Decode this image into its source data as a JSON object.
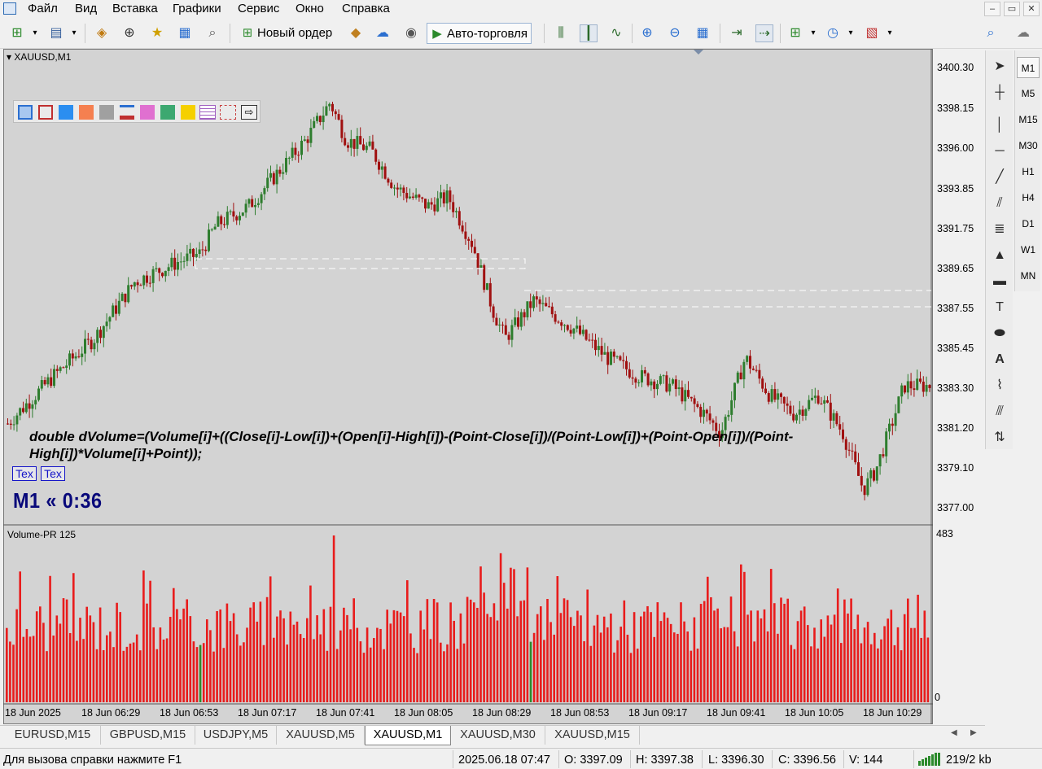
{
  "menu": {
    "items": [
      "Файл",
      "Вид",
      "Вставка",
      "Графики",
      "Сервис",
      "Окно",
      "Справка"
    ]
  },
  "toolbar": {
    "new_order": "Новый ордер",
    "auto_trading": "Авто-торговля"
  },
  "chart": {
    "title": "XAUUSD,M1",
    "price_axis": [
      "3400.30",
      "3398.15",
      "3396.00",
      "3393.85",
      "3391.75",
      "3389.65",
      "3387.55",
      "3385.45",
      "3383.30",
      "3381.20",
      "3379.10",
      "3377.00"
    ],
    "time_axis": [
      "18 Jun 2025",
      "18 Jun 06:29",
      "18 Jun 06:53",
      "18 Jun 07:17",
      "18 Jun 07:41",
      "18 Jun 08:05",
      "18 Jun 08:29",
      "18 Jun 08:53",
      "18 Jun 09:17",
      "18 Jun 09:41",
      "18 Jun 10:05",
      "18 Jun 10:29"
    ],
    "formula": "double dVolume=(Volume[i]+((Close[i]-Low[i])+(Open[i]-High[i])-(Point-Close[i])/(Point-Low[i])+(Point-Open[i])/(Point-High[i])*Volume[i]+Point));",
    "tex_buttons": [
      "Tex",
      "Tex"
    ],
    "timer": "M1  «  0:36",
    "palette_colors": [
      "#a8c8f0",
      "#c03030",
      "#2b8ef0",
      "#f58050",
      "#a0a0a0",
      "#2b6fd0",
      "#e070d0",
      "#3ca870",
      "#f5d000",
      "#a060c0",
      "#c84040"
    ],
    "candle_up_color": "#2e7d2e",
    "candle_down_color": "#a01010"
  },
  "subwindow": {
    "title": "Volume-PR 125",
    "max_label": "483",
    "min_label": "0",
    "bar_color": "#e81c1c",
    "highlight_color": "#2b8a2b"
  },
  "timeframes": [
    "M1",
    "M5",
    "M15",
    "M30",
    "H1",
    "H4",
    "D1",
    "W1",
    "MN"
  ],
  "tabs": [
    "EURUSD,M15",
    "GBPUSD,M15",
    "USDJPY,M5",
    "XAUUSD,M5",
    "XAUUSD,M1",
    "XAUUSD,M30",
    "XAUUSD,M15"
  ],
  "status": {
    "help": "Для вызова справки нажмите F1",
    "datetime": "2025.06.18 07:47",
    "open": "O: 3397.09",
    "high": "H: 3397.38",
    "low": "L: 3396.30",
    "close": "C: 3396.56",
    "volume": "V: 144",
    "traffic": "219/2 kb"
  }
}
